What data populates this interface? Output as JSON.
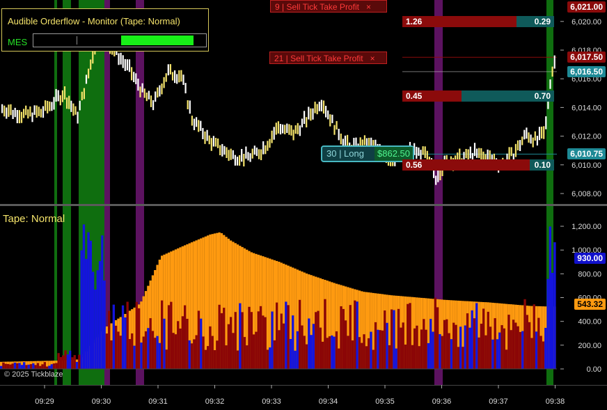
{
  "monitor": {
    "title": "Audible Orderflow - Monitor (Tape: Normal)",
    "symbol": "MES",
    "meter_level": 0.43
  },
  "orders": [
    {
      "label": "9 | Sell Tick Take Profit",
      "close": "×",
      "price": 6021.0
    },
    {
      "label": "21 | Sell Tick Take Profit",
      "close": "×",
      "price": 6017.5
    }
  ],
  "position": {
    "qty_label": "30 | Long",
    "pnl": "$862.50",
    "price": 6010.75
  },
  "bid_ask": [
    {
      "left": "1.26",
      "right": "0.29",
      "left_share": 0.75
    },
    {
      "left": "0.45",
      "right": "0.70",
      "left_share": 0.39
    },
    {
      "left": "0.56",
      "right": "0.10",
      "left_share": 0.84
    }
  ],
  "price_axis": {
    "ticks": [
      "6,008.00",
      "6,010.00",
      "6,012.00",
      "6,014.00",
      "6,016.00",
      "6,018.00",
      "6,020.00"
    ],
    "labels": [
      {
        "text": "6,021.00",
        "price": 6021.0,
        "bg": "#8b0b0b",
        "fg": "#ffffff"
      },
      {
        "text": "6,017.50",
        "price": 6017.5,
        "bg": "#8b0b0b",
        "fg": "#ffffff"
      },
      {
        "text": "6,016.50",
        "price": 6016.5,
        "bg": "#1e8a96",
        "fg": "#ffffff"
      },
      {
        "text": "6,010.75",
        "price": 6010.75,
        "bg": "#1e8a96",
        "fg": "#ffffff"
      }
    ]
  },
  "tape_panel": {
    "label": "Tape: Normal",
    "ticks": [
      "0.00",
      "200.00",
      "400.00",
      "600.00",
      "800.00",
      "1,000.00",
      "1,200.00"
    ],
    "labels": [
      {
        "text": "930.00",
        "value": 930,
        "bg": "#1111cc",
        "fg": "#ffffff"
      },
      {
        "text": "543.32",
        "value": 543.32,
        "bg": "#ff9a10",
        "fg": "#000000"
      }
    ]
  },
  "time_axis": {
    "labels": [
      "09:29",
      "09:30",
      "09:31",
      "09:32",
      "09:33",
      "09:34",
      "09:35",
      "09:36",
      "09:37",
      "09:38"
    ]
  },
  "copyright": "© 2025 Tickblaze",
  "colors": {
    "background": "#000000",
    "candle_up": "#ffffff",
    "candle_down": "#f4e36a",
    "highlight_green": "#0f6e0f",
    "highlight_purple": "#5c1260",
    "tape_avg": "#ff9a10",
    "tape_buy": "#1414dd",
    "tape_sell": "#8b0606",
    "bid": "#8b0b0b",
    "ask": "#0f5a5a"
  }
}
